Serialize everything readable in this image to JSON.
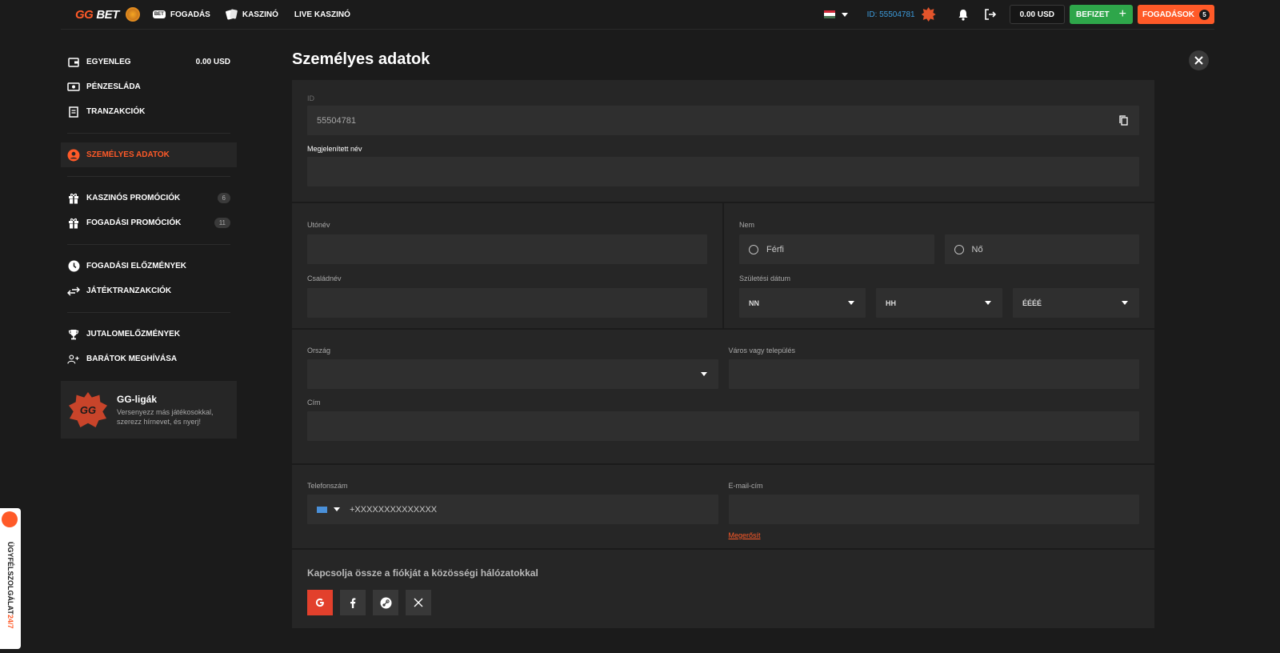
{
  "header": {
    "logo_gg": "GG",
    "logo_bet": "BET",
    "nav": [
      {
        "label": "FOGADÁS",
        "icon": "bet-icon"
      },
      {
        "label": "KASZINÓ",
        "icon": "cards-icon"
      },
      {
        "label": "LIVE KASZINÓ",
        "icon": ""
      }
    ],
    "user_id": "ID: 55504781",
    "balance": "0.00 USD",
    "deposit_label": "BEFIZET",
    "bets_label": "FOGADÁSOK",
    "bets_count": "5",
    "flag_colors": [
      "#ce2939",
      "#ffffff",
      "#477050"
    ]
  },
  "sidebar": {
    "group1": [
      {
        "label": "EGYENLEG",
        "value": "0.00 USD",
        "icon": "wallet-icon"
      },
      {
        "label": "PÉNZESLÁDA",
        "icon": "cash-icon"
      },
      {
        "label": "TRANZAKCIÓK",
        "icon": "receipt-icon"
      }
    ],
    "active": {
      "label": "SZEMÉLYES ADATOK",
      "icon": "user-circle-icon"
    },
    "group2": [
      {
        "label": "KASZINÓS PROMÓCIÓK",
        "badge": "6",
        "icon": "gift-icon"
      },
      {
        "label": "FOGADÁSI PROMÓCIÓK",
        "badge": "11",
        "icon": "gift-icon"
      }
    ],
    "group3": [
      {
        "label": "FOGADÁSI ELŐZMÉNYEK",
        "icon": "clock-icon"
      },
      {
        "label": "JÁTÉKTRANZAKCIÓK",
        "icon": "swap-arrows-icon"
      }
    ],
    "group4": [
      {
        "label": "JUTALOMELŐZMÉNYEK",
        "icon": "trophy-icon"
      },
      {
        "label": "BARÁTOK MEGHÍVÁSA",
        "icon": "add-friends-icon"
      }
    ],
    "gg_card": {
      "logo": "GG",
      "title": "GG-ligák",
      "desc": "Versenyezz más játékosokkal, szerezz hírnevet, és nyerj!"
    }
  },
  "main": {
    "title": "Személyes adatok",
    "id": {
      "label": "ID",
      "value": "55504781"
    },
    "display_name": {
      "label": "Megjelenített név",
      "value": ""
    },
    "first_name": {
      "label": "Utónév",
      "value": ""
    },
    "last_name": {
      "label": "Családnév",
      "value": ""
    },
    "gender": {
      "label": "Nem",
      "options": [
        "Férfi",
        "Nő"
      ]
    },
    "birth_date": {
      "label": "Születési dátum",
      "day": "NN",
      "month": "HH",
      "year": "ÉÉÉÉ"
    },
    "country": {
      "label": "Ország",
      "value": ""
    },
    "city": {
      "label": "Város vagy település",
      "value": ""
    },
    "address": {
      "label": "Cím",
      "value": ""
    },
    "phone": {
      "label": "Telefonszám",
      "value": "+XXXXXXXXXXXXXX"
    },
    "email": {
      "label": "E-mail-cím",
      "value": "",
      "verify_label": "Megerősít"
    },
    "social": {
      "title": "Kapcsolja össze a fiókját a közösségi hálózatokkal",
      "networks": [
        "google",
        "facebook",
        "steam",
        "x"
      ]
    }
  },
  "support": {
    "label_main": "ÜGYFÉLSZOLGÁLAT ",
    "label_hl": "24/7"
  },
  "colors": {
    "accent": "#ff5a28",
    "deposit": "#2ea64a",
    "link_blue": "#3d9bdb"
  }
}
